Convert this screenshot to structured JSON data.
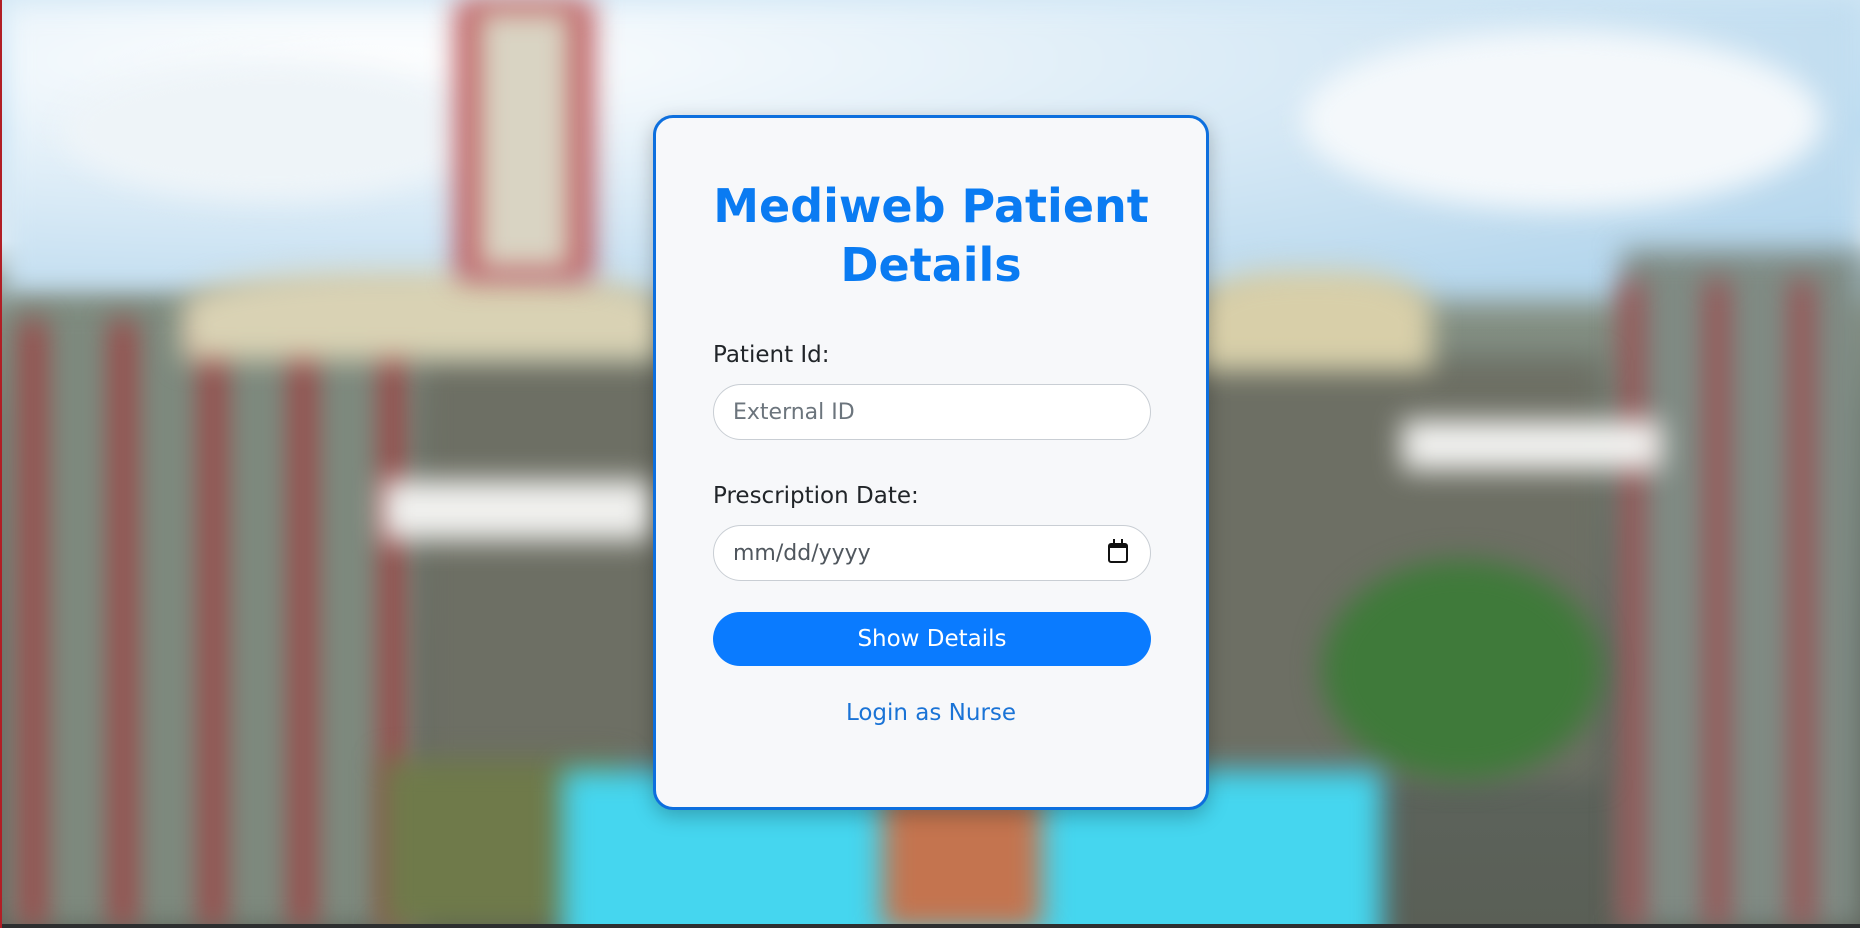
{
  "page": {
    "title": "Mediweb Patient Details"
  },
  "form": {
    "patient_id": {
      "label": "Patient Id:",
      "placeholder": "External ID",
      "value": ""
    },
    "prescription_date": {
      "label": "Prescription Date:",
      "placeholder": "mm/dd/yyyy",
      "icon": "calendar-icon"
    },
    "submit_label": "Show Details",
    "nurse_login_link": "Login as Nurse"
  },
  "colors": {
    "accent": "#0a7bff",
    "title": "#0a7bf2",
    "card_border": "#0d6fde",
    "card_bg": "#f7f8fa"
  }
}
